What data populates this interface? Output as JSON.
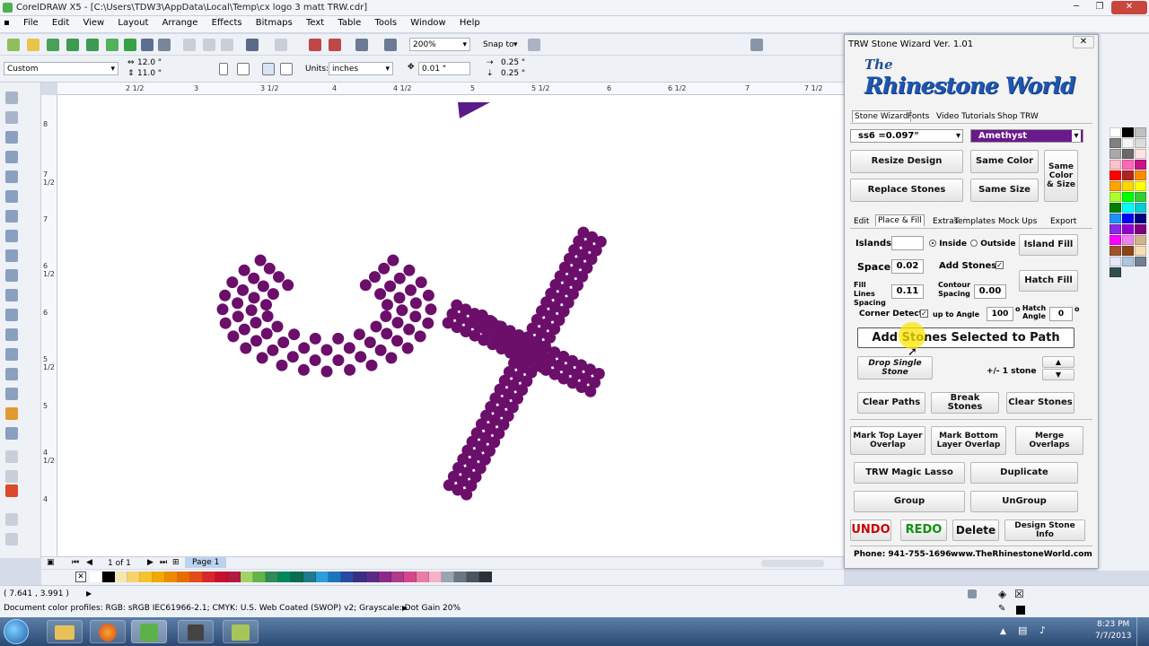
{
  "window": {
    "title": "CorelDRAW X5 - [C:\\Users\\TDW3\\AppData\\Local\\Temp\\cx logo 3 matt TRW.cdr]"
  },
  "menu": [
    "File",
    "Edit",
    "View",
    "Layout",
    "Arrange",
    "Effects",
    "Bitmaps",
    "Text",
    "Table",
    "Tools",
    "Window",
    "Help"
  ],
  "toolbar": {
    "zoom": "200%",
    "snap_to": "Snap to"
  },
  "propbar": {
    "preset": "Custom",
    "width": "12.0 \"",
    "height": "11.0 \"",
    "units_label": "Units:",
    "units": "inches",
    "nudge": "0.01 \"",
    "dup_x": "0.25 \"",
    "dup_y": "0.25 \""
  },
  "ruler_top": [
    "2 1/2",
    "3",
    "3 1/2",
    "4",
    "4 1/2",
    "5",
    "5 1/2",
    "6",
    "6 1/2",
    "7",
    "7 1/2"
  ],
  "ruler_left": [
    "8",
    "7 1/2",
    "7",
    "6 1/2",
    "6",
    "5 1/2",
    "5",
    "4 1/2",
    "4"
  ],
  "pagenav": {
    "pages": "1 of 1",
    "tab": "Page 1"
  },
  "status": {
    "coords": "( 7.641 , 3.991 )",
    "profiles": "Document color profiles: RGB: sRGB IEC61966-2.1; CMYK: U.S. Web Coated (SWOP) v2; Grayscale: Dot Gain 20%"
  },
  "taskbar": {
    "time": "8:23 PM",
    "date": "7/7/2013"
  },
  "wizard": {
    "title": "TRW Stone Wizard Ver. 1.01",
    "logo_the": "The",
    "logo_name": "Rhinestone World",
    "top_tabs": [
      "Stone Wizard",
      "Fonts",
      "Video Tutorials",
      "Shop TRW"
    ],
    "stone_size": "ss6 =0.097\"",
    "stone_color": "Amethyst",
    "stone_color_hex": "#6a1a8a",
    "buttons": {
      "resize_design": "Resize Design",
      "same_color": "Same Color",
      "same_color_size": "Same Color & Size",
      "replace_stones": "Replace Stones",
      "same_size": "Same Size"
    },
    "sub_tabs": [
      "Edit",
      "Place & Fill",
      "Extras",
      "Templates",
      "Mock Ups",
      "Export"
    ],
    "islands_label": "Islands",
    "inside_label": "Inside",
    "outside_label": "Outside",
    "island_fill": "Island Fill",
    "space_label": "Space",
    "space_value": "0.02",
    "add_stones_label": "Add Stones",
    "hatch_fill": "Hatch Fill",
    "fill_lines_label": "Fill Lines Spacing",
    "fill_lines_value": "0.11",
    "contour_label": "Contour Spacing",
    "contour_value": "0.00",
    "corner_detect_label": "Corner Detect",
    "up_to_angle_label": "up to Angle",
    "angle_value": "100",
    "hatch_angle_label": "Hatch Angle",
    "hatch_angle_value": "0",
    "degree": "o",
    "add_to_path": "Add Stones Selected to Path",
    "drop_single": "Drop Single Stone",
    "plus_minus": "+/- 1 stone",
    "clear_paths": "Clear Paths",
    "break_stones": "Break Stones",
    "clear_stones": "Clear Stones",
    "mark_top": "Mark Top Layer Overlap",
    "mark_bottom": "Mark Bottom Layer Overlap",
    "merge_overlaps": "Merge Overlaps",
    "magic_lasso": "TRW Magic Lasso",
    "duplicate": "Duplicate",
    "group": "Group",
    "ungroup": "UnGroup",
    "undo": "UNDO",
    "redo": "REDO",
    "delete": "Delete",
    "design_info": "Design Stone Info",
    "phone": "Phone: 941-755-1696",
    "website": "www.TheRhinestoneWorld.com"
  },
  "colors": {
    "stone": "#6b0f6b",
    "accent": "#6a1a8a",
    "undo": "#cc0000",
    "redo": "#109010"
  }
}
